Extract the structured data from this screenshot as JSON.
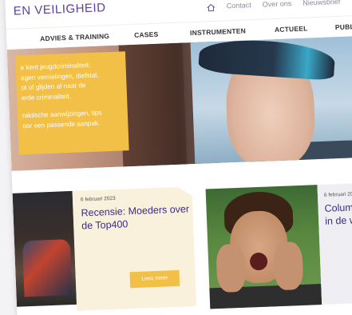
{
  "header": {
    "logo_text": "EN VEILIGHEID",
    "top_links": [
      "Contact",
      "Over ons",
      "Nieuwsbrief"
    ]
  },
  "nav": {
    "items": [
      "ADVIES & TRAINING",
      "CASES",
      "INSTRUMENTEN",
      "ACTUEEL",
      "PUBL"
    ]
  },
  "hero": {
    "card_paragraph_1": "...e kent jeugdcriminaliteit: ...gen vernielingen, diefstal, ...ot of glijden af naar de ...rde criminaliteit.",
    "card_lines_1": [
      "e kent jeugdcriminaliteit:",
      "agen vernielingen, diefstal,",
      "ot of glijden af naar de",
      "erde criminaliteit."
    ],
    "card_lines_2": [
      "raktische aanwijzingen, tips",
      "oor een passende aanpak."
    ]
  },
  "articles": [
    {
      "date": "6 februari 2023",
      "title_lines": [
        "Recensie: Moeders over",
        "de Top400"
      ],
      "button_label": "Lees meer"
    },
    {
      "date": "6 februari 20",
      "title_lines": [
        "Column:",
        "in de wo"
      ]
    }
  ],
  "colors": {
    "accent_yellow": "#f2bf47",
    "brand_purple": "#3c2a8a",
    "logo_purple": "#5b3fa0"
  }
}
